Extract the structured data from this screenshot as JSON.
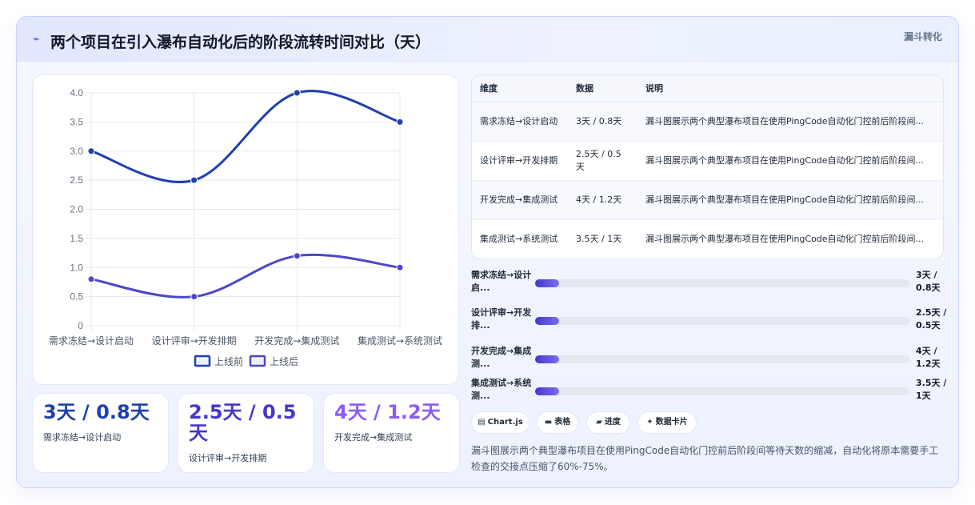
{
  "header": {
    "title": "两个项目在引入瀑布自动化后的阶段流转时间对比（天）",
    "tag": "漏斗转化",
    "icon": "trend-icon"
  },
  "chart_data": {
    "type": "line",
    "categories": [
      "需求冻结→设计启动",
      "设计评审→开发排期",
      "开发完成→集成测试",
      "集成测试→系统测试"
    ],
    "series": [
      {
        "name": "上线前",
        "values": [
          3,
          2.5,
          4,
          3.5
        ],
        "color": "#1e40af"
      },
      {
        "name": "上线后",
        "values": [
          0.8,
          0.5,
          1.2,
          1
        ],
        "color": "#4f46c8"
      }
    ],
    "yticks": [
      "0",
      "0.5",
      "1.0",
      "1.5",
      "2.0",
      "2.5",
      "3.0",
      "3.5",
      "4.0"
    ],
    "ylim": [
      0,
      4
    ],
    "grid": true,
    "legend": "bottom"
  },
  "kpis": [
    {
      "value": "3天 / 0.8天",
      "label": "需求冻结→设计启动",
      "color": "#1e40af"
    },
    {
      "value": "2.5天 / 0.5天",
      "label": "设计评审→开发排期",
      "color": "#4338ca"
    },
    {
      "value": "4天 / 1.2天",
      "label": "开发完成→集成测试",
      "color": "#8b5cf6"
    }
  ],
  "table": {
    "headers": [
      "维度",
      "数据",
      "说明"
    ],
    "rows": [
      {
        "dim": "需求冻结→设计启动",
        "data": "3天 / 0.8天",
        "note": "漏斗图展示两个典型瀑布项目在使用PingCode自动化门控前后阶段间..."
      },
      {
        "dim": "设计评审→开发排期",
        "data": "2.5天 / 0.5天",
        "note": "漏斗图展示两个典型瀑布项目在使用PingCode自动化门控前后阶段间..."
      },
      {
        "dim": "开发完成→集成测试",
        "data": "4天 / 1.2天",
        "note": "漏斗图展示两个典型瀑布项目在使用PingCode自动化门控前后阶段间..."
      },
      {
        "dim": "集成测试→系统测试",
        "data": "3.5天 / 1天",
        "note": "漏斗图展示两个典型瀑布项目在使用PingCode自动化门控前后阶段间..."
      }
    ]
  },
  "progress": [
    {
      "label": "需求冻结→设计启...",
      "value": "3天 / 0.8天",
      "fraction": 0.065
    },
    {
      "label": "设计评审→开发排...",
      "value": "2.5天 / 0.5天",
      "fraction": 0.065
    },
    {
      "label": "开发完成→集成测...",
      "value": "4天 / 1.2天",
      "fraction": 0.065
    },
    {
      "label": "集成测试→系统测...",
      "value": "3.5天 / 1天",
      "fraction": 0.065
    }
  ],
  "chips": [
    {
      "label": "Chart.js",
      "icon": "chart-icon",
      "glyph": "▤"
    },
    {
      "label": "表格",
      "icon": "table-icon",
      "glyph": "▬"
    },
    {
      "label": "进度",
      "icon": "progress-icon",
      "glyph": "▰"
    },
    {
      "label": "数据卡片",
      "icon": "sparkle-icon",
      "glyph": "✦"
    }
  ],
  "description": "漏斗图展示两个典型瀑布项目在使用PingCode自动化门控前后阶段间等待天数的缩减，自动化将原本需要手工检查的交接点压缩了60%-75%。"
}
